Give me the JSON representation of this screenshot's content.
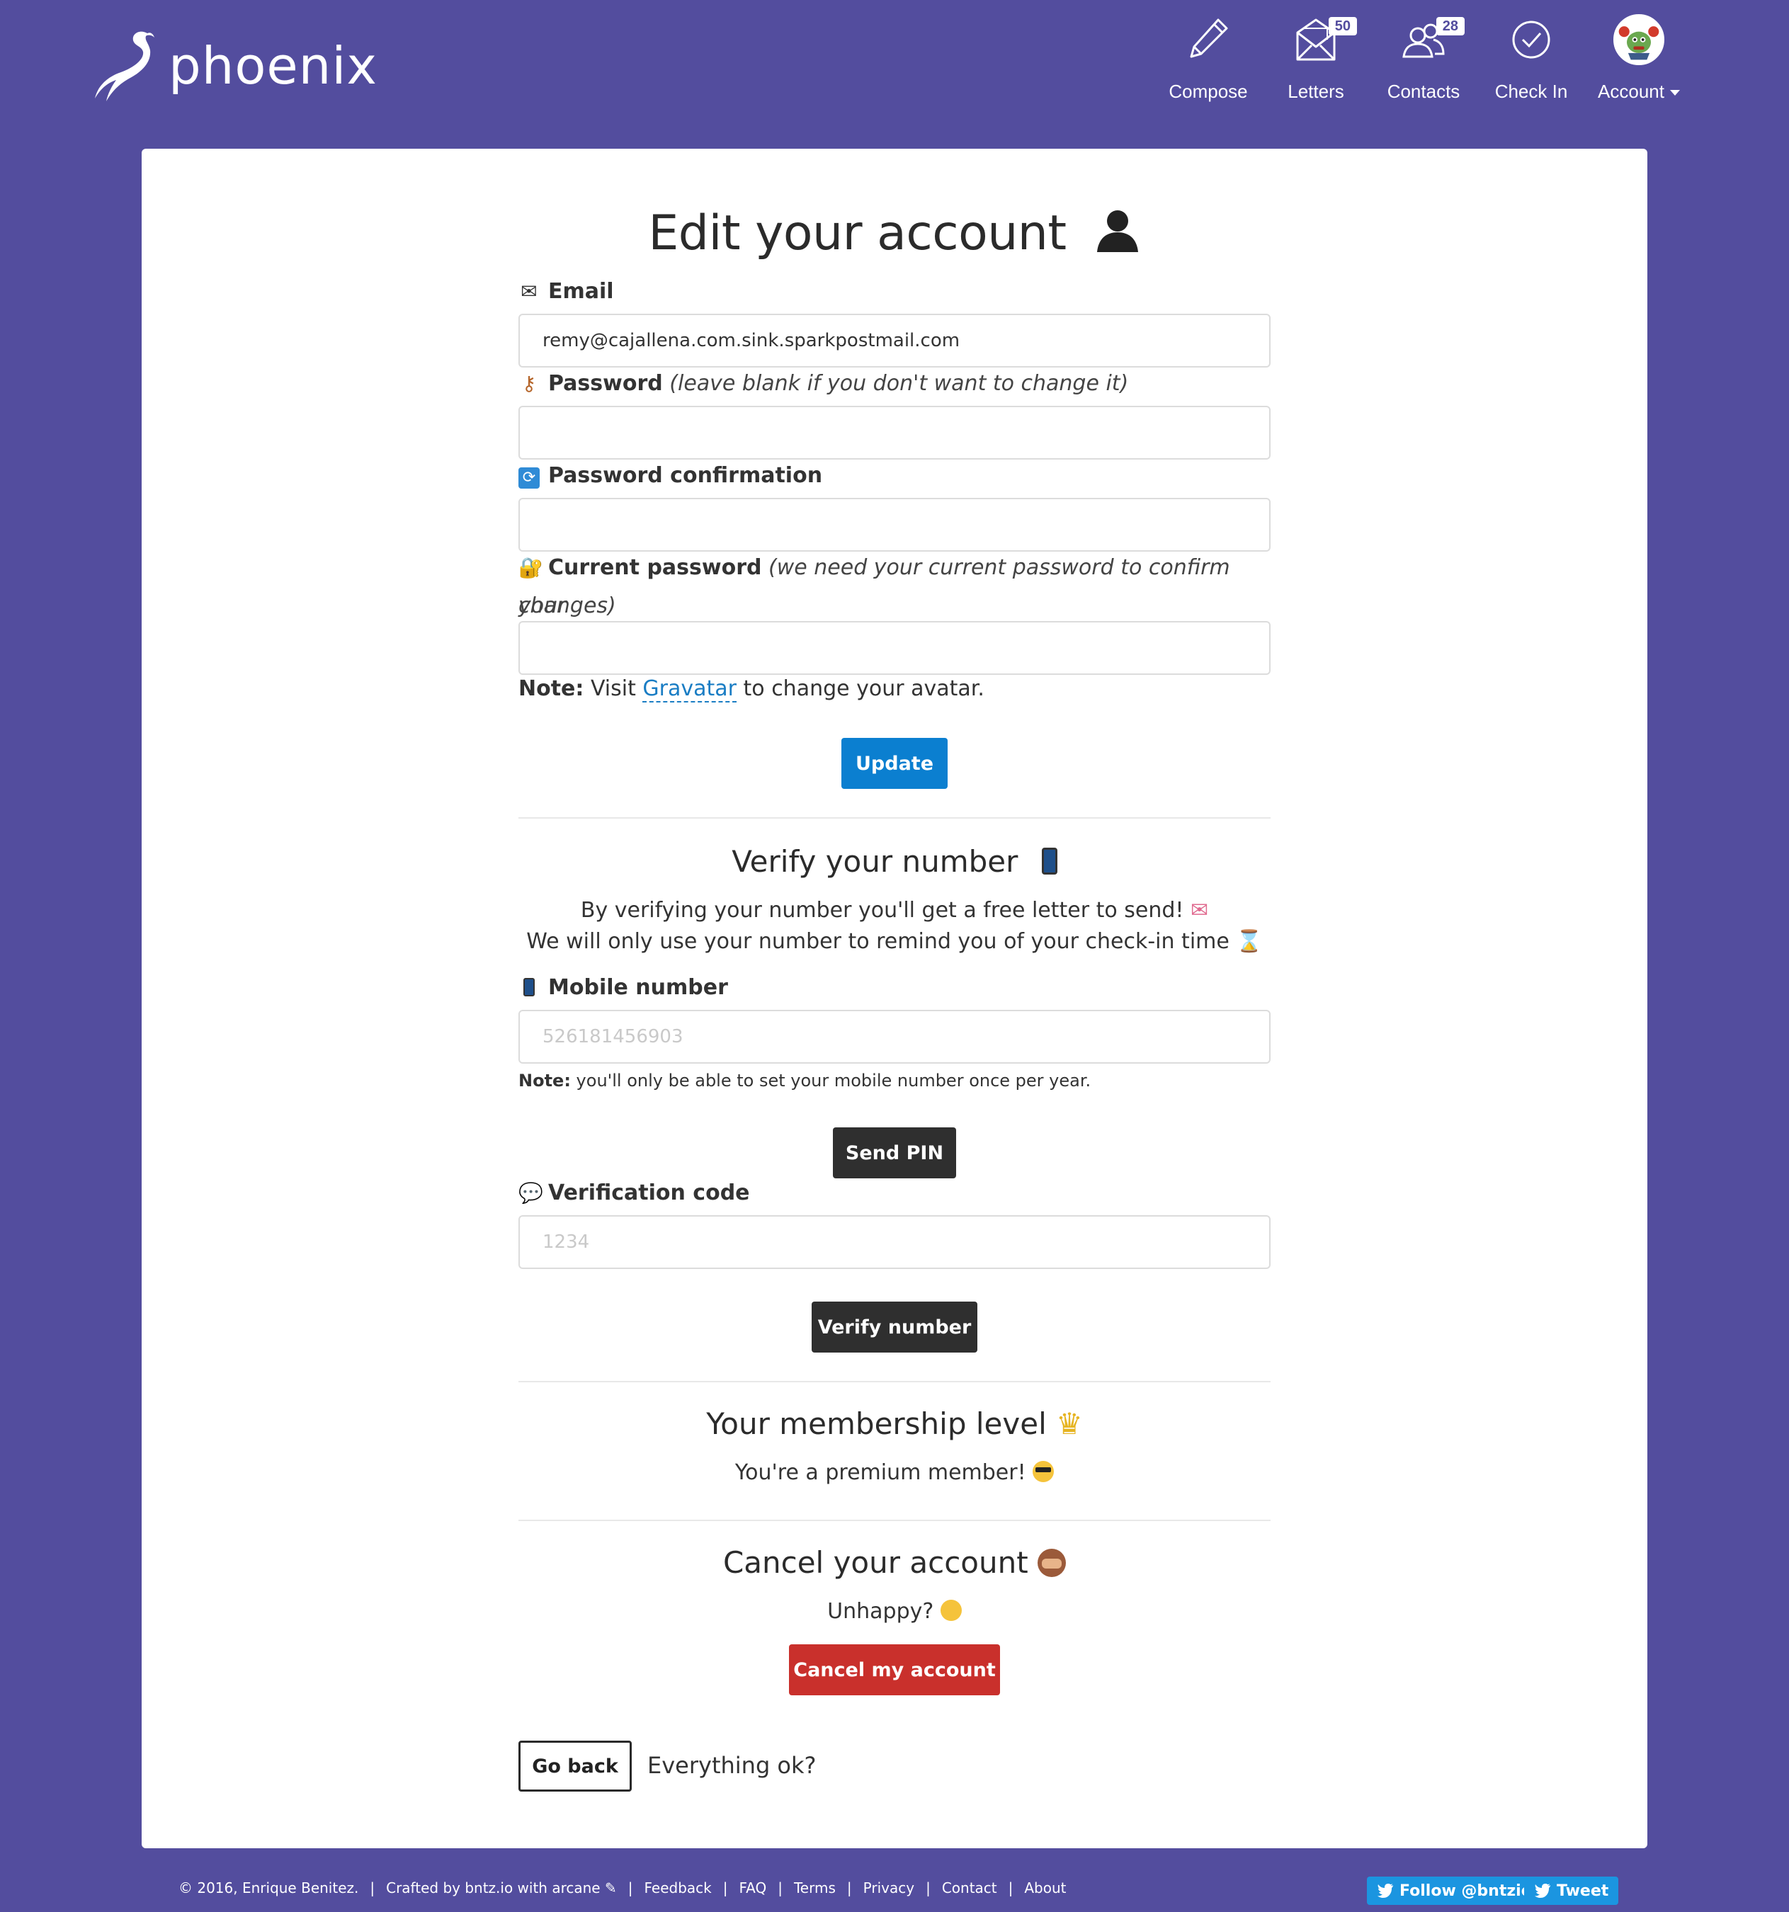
{
  "app": {
    "name": "phoenix"
  },
  "nav": {
    "compose": {
      "label": "Compose"
    },
    "letters": {
      "label": "Letters",
      "badge": "50"
    },
    "contacts": {
      "label": "Contacts",
      "badge": "28"
    },
    "checkin": {
      "label": "Check In"
    },
    "account": {
      "label": "Account"
    }
  },
  "page": {
    "title": "Edit your account"
  },
  "form": {
    "email": {
      "label": "Email",
      "value": "remy@cajallena.com.sink.sparkpostmail.com"
    },
    "password": {
      "label": "Password",
      "hint": "(leave blank if you don't want to change it)"
    },
    "password_confirmation": {
      "label": "Password confirmation"
    },
    "current_password": {
      "label": "Current password",
      "hint": "(we need your current password to confirm your",
      "hint2": "changes)"
    },
    "avatar_note": {
      "bold": "Note:",
      "pre": " Visit ",
      "link": "Gravatar",
      "post": " to change your avatar."
    },
    "update_button": "Update"
  },
  "verify": {
    "title": "Verify your number",
    "line1": "By verifying your number you'll get a free letter to send!",
    "line2": "We will only use your number to remind you of your check-in time",
    "mobile": {
      "label": "Mobile number",
      "placeholder": "526181456903"
    },
    "note": {
      "bold": "Note:",
      "text": " you'll only be able to set your mobile number once per year."
    },
    "send_pin_button": "Send PIN",
    "code": {
      "label": "Verification code",
      "placeholder": "1234"
    },
    "verify_button": "Verify number"
  },
  "membership": {
    "title": "Your membership level",
    "text": "You're a premium member!"
  },
  "cancel": {
    "title": "Cancel your account",
    "text": "Unhappy?",
    "button": "Cancel my account"
  },
  "back": {
    "button": "Go back",
    "text": "Everything ok?"
  },
  "footer": {
    "copyright": "© 2016, Enrique Benitez.",
    "crafted": "Crafted by bntz.io with arcane",
    "links": [
      "Feedback",
      "FAQ",
      "Terms",
      "Privacy",
      "Contact",
      "About"
    ],
    "follow": "Follow @bntzio",
    "tweet": "Tweet"
  },
  "colors": {
    "background": "#534d9e",
    "primary": "#0b7fd0",
    "danger": "#c9302c",
    "dark": "#2f2f2f"
  }
}
